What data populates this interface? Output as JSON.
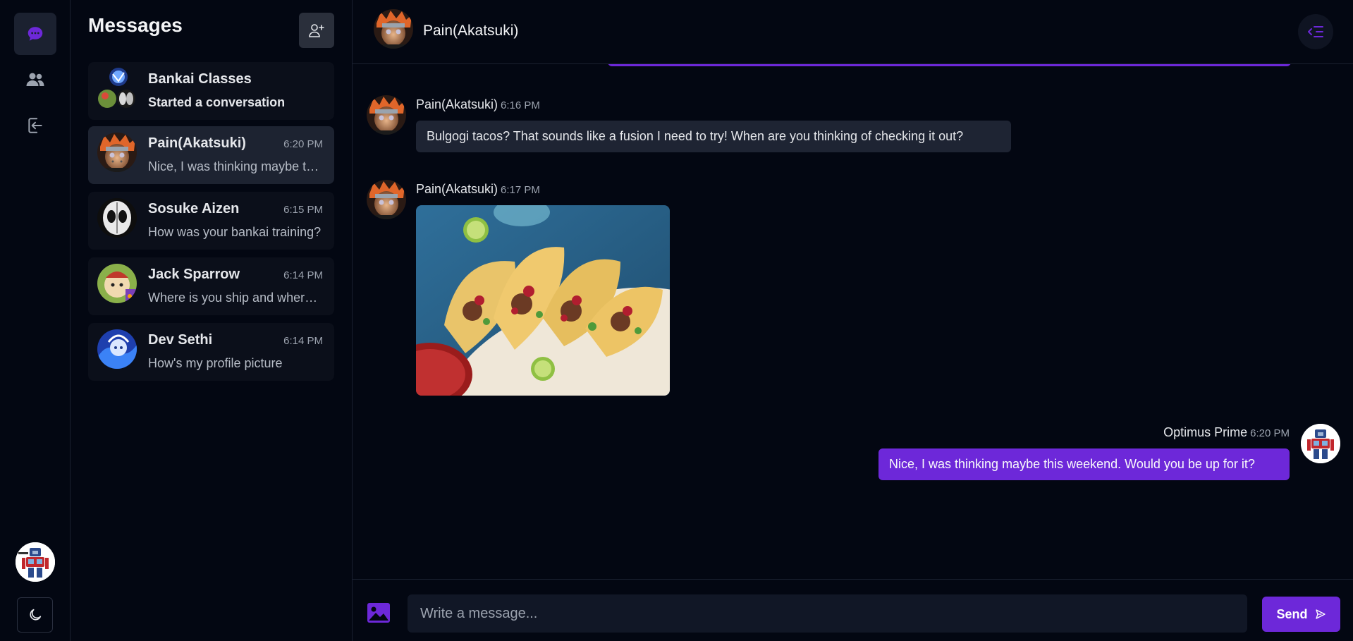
{
  "nav": {
    "chats_icon": "chat-bubble-icon",
    "contacts_icon": "users-icon",
    "logout_icon": "logout-icon",
    "theme_icon": "moon-icon",
    "accent": "#6d28d9"
  },
  "sidebar": {
    "title": "Messages",
    "add_contact_icon": "add-user-icon",
    "conversations": [
      {
        "name": "Bankai Classes",
        "time": "",
        "preview": "Started a conversation"
      },
      {
        "name": "Pain(Akatsuki)",
        "time": "6:20 PM",
        "preview": "Nice, I was thinking maybe this weekend. Would you be up for it?"
      },
      {
        "name": "Sosuke Aizen",
        "time": "6:15 PM",
        "preview": "How was your bankai training?"
      },
      {
        "name": "Jack Sparrow",
        "time": "6:14 PM",
        "preview": "Where is you ship and where is the rum?"
      },
      {
        "name": "Dev Sethi",
        "time": "6:14 PM",
        "preview": "How's my profile picture"
      }
    ]
  },
  "chat": {
    "contact_name": "Pain(Akatsuki)",
    "toggle_icon": "panel-collapse-icon",
    "messages": [
      {
        "sender": "Pain(Akatsuki)",
        "time": "6:16 PM",
        "text": "Bulgogi tacos? That sounds like a fusion I need to try! When are you thinking of checking it out?"
      },
      {
        "sender": "Pain(Akatsuki)",
        "time": "6:17 PM",
        "image": "tacos-photo"
      },
      {
        "sender": "Optimus Prime",
        "time": "6:20 PM",
        "text": "Nice, I was thinking maybe this weekend. Would you be up for it?"
      }
    ]
  },
  "composer": {
    "placeholder": "Write a message...",
    "image_icon": "image-icon",
    "send_label": "Send",
    "send_icon": "send-icon"
  }
}
